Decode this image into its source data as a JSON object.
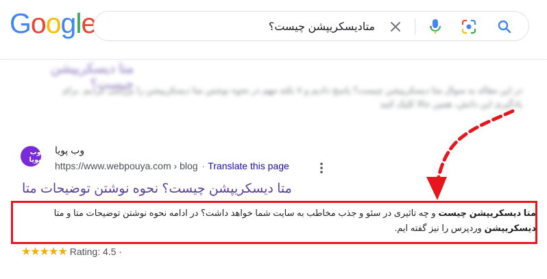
{
  "logo": {
    "letters": [
      "G",
      "o",
      "o",
      "g",
      "l",
      "e"
    ],
    "colors": [
      "#4285F4",
      "#EA4335",
      "#FBBC05",
      "#4285F4",
      "#34A853",
      "#EA4335"
    ]
  },
  "search": {
    "query": "متادیسکریپشن چیست؟"
  },
  "icons": {
    "clear": "close-icon",
    "mic": "microphone-icon",
    "lens": "google-lens-icon",
    "search": "search-icon",
    "more": "more-vert-icon"
  },
  "blurred_result": {
    "title": "متا دیسکریپشن چیست؟",
    "line1": "در این مقاله به سوال متا دیسکریپشن چیست؟ پاسخ دادیم و ۷ نکته مهم در نحوه نوشتن متا دیسکریپشن را بررسی کردیم. برای",
    "line2": "یادگیری این دانش، همین حالا کلیک کنید"
  },
  "result": {
    "favicon_text": "وب پویا",
    "site_name": "وب پویا",
    "url": "https://www.webpouya.com › blog",
    "url_separator": "·",
    "translate": "Translate this page",
    "title": "متا دیسکریپشن چیست؟ نحوه نوشتن توضیحات متا",
    "snippet": {
      "b1": "متا دیسکریپشن چیست",
      "t1": " و چه تاثیری در سئو و جذب مخاطب به سایت شما خواهد داشت؟ در ادامه نحوه نوشتن توضیحات متا و متا ",
      "b2": "دیسکریپشن",
      "t2": " وردپرس را نیز گفته ایم."
    },
    "stars": "★★★★★",
    "rating": "Rating: 4.5 ·",
    "rating_value": 4.5
  },
  "colors": {
    "highlight_box": "#e5161c",
    "title_visited": "#5a3fa0",
    "link": "#1a0dab"
  }
}
